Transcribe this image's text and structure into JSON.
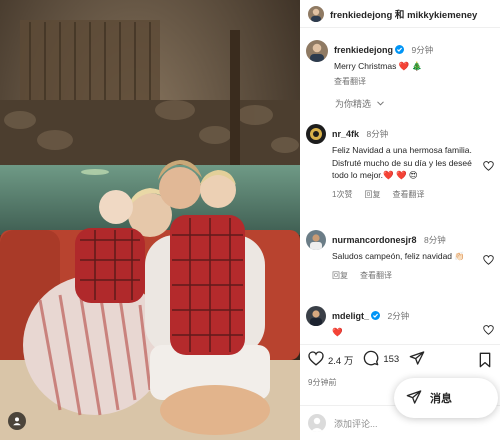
{
  "post": {
    "header_names": "frenkiedejong 和 mikkykiemeney",
    "caption_user": "frenkiedejong",
    "caption_time": "9分钟",
    "caption_text": "Merry Christmas ❤️ 🎄",
    "caption_translate": "查看翻译",
    "for_you": "为你精选"
  },
  "comments": [
    {
      "user": "nr_4fk",
      "time": "8分钟",
      "text": "Feliz Navidad a una hermosa familia. Disfruté mucho de su día y les deseé todo lo mejor.❤️ ❤️ 😍",
      "likes": "1次赞",
      "reply": "回复",
      "translate": "查看翻译"
    },
    {
      "user": "nurmancordonesjr8",
      "time": "8分钟",
      "text": "Saludos campeón, feliz navidad 👏🏻",
      "reply": "回复",
      "translate": "查看翻译"
    },
    {
      "user": "mdeligt_",
      "time": "2分钟",
      "text": "❤️"
    }
  ],
  "actions": {
    "likes_count": "2.4 万",
    "comments_count": "153"
  },
  "timestamp": "9分钟前",
  "comment_input": {
    "placeholder": "添加评论..."
  },
  "messages_button": {
    "label": "消息"
  },
  "icons": {
    "like": "heart-icon",
    "comment": "comment-bubble-icon",
    "share": "send-icon",
    "save": "bookmark-icon",
    "messages": "send-icon",
    "photo_user": "user-icon"
  },
  "colors": {
    "verified": "#0095f6",
    "heart": "#ed4956",
    "muted": "#737373"
  }
}
